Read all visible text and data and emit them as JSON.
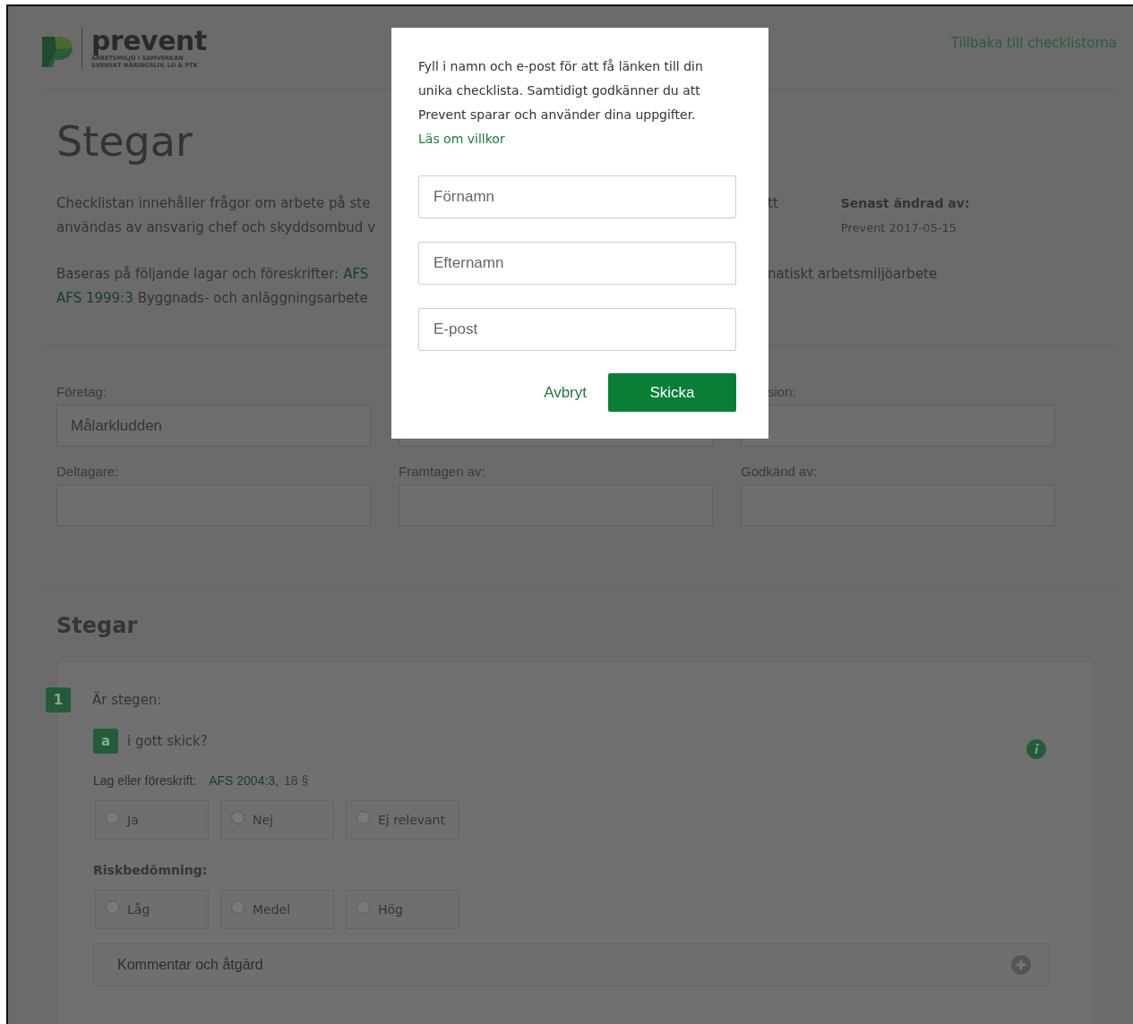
{
  "header": {
    "logo": {
      "wordmark": "prevent",
      "tagline": [
        "ARBETSMILJÖ I SAMVERKAN",
        "SVENSKT NÄRINGSLIV, LO & PTK"
      ]
    },
    "back_link": "Tillbaka till checklistorna"
  },
  "title": "Stegar",
  "description": {
    "lines": [
      "Checklistan innehåller frågor om arbete på ste",
      "användas av ansvarig chef och skyddsombud v"
    ],
    "tail": "tt"
  },
  "meta": {
    "label": "Senast ändrad av:",
    "value": "Prevent 2017-05-15"
  },
  "basis": {
    "lines": [
      [
        {
          "kind": "text",
          "text": "Baseras på följande lagar och föreskrifter:"
        },
        {
          "kind": "link",
          "text": "AFS"
        }
      ],
      [
        {
          "kind": "link",
          "text": "AFS 1999:3"
        },
        {
          "kind": "text",
          "text": "Byggnads- och anläggningsarbete"
        }
      ]
    ],
    "tail": "natiskt arbetsmiljöarbete"
  },
  "form": {
    "rows": [
      [
        {
          "label": "Företag:",
          "value": "Målarkludden"
        },
        {},
        {
          "label": "sion:"
        }
      ],
      [
        {
          "label": "Deltagare:"
        },
        {
          "label": "Framtagen av:"
        },
        {
          "label": "Godkänd av:"
        }
      ]
    ]
  },
  "section": {
    "title": "Stegar",
    "questions": [
      {
        "number": "1",
        "text": "Är stegen:",
        "items": [
          {
            "letter": "a",
            "text": "i gott skick?",
            "law_label": "Lag eller föreskrift:",
            "law_link": "AFS 2004:3,",
            "law_rest": "18 §",
            "answers": [
              {
                "label": "Ja",
                "selected": false
              },
              {
                "label": "Nej",
                "selected": false
              },
              {
                "label": "Ej relevant",
                "selected": false
              }
            ],
            "risk_label": "Riskbedömning:",
            "risks": [
              {
                "label": "Låg",
                "selected": false
              },
              {
                "label": "Medel",
                "selected": false
              },
              {
                "label": "Hög",
                "selected": false
              }
            ],
            "comment": "Kommentar och åtgärd"
          }
        ]
      }
    ]
  },
  "modal": {
    "text": "Fyll i namn och e-post för att få länken till din unika checklista. Samtidigt godkänner du att Prevent sparar och använder dina uppgifter.",
    "link": "Läs om villkor",
    "fields": [
      {
        "placeholder": "Förnamn"
      },
      {
        "placeholder": "Efternamn"
      },
      {
        "placeholder": "E-post"
      }
    ],
    "cancel": "Avbryt",
    "submit": "Skicka"
  }
}
